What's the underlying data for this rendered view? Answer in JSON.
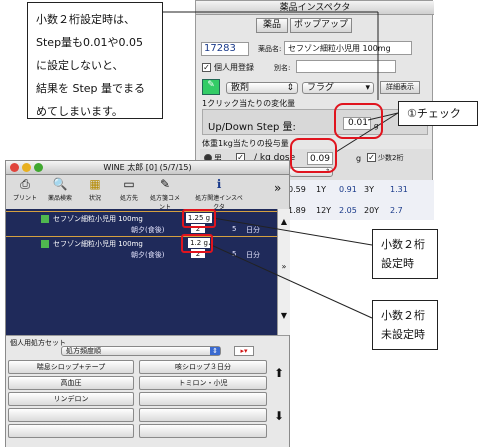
{
  "callouts": {
    "main_lines": [
      "小数２桁設定時は、",
      "Step量も0.01や0.05",
      "に設定しないと、",
      "結果を Step 量でまる",
      "めてしまいます。"
    ],
    "check_label": "①チェック",
    "two_digit_set": [
      "小数２桁",
      "設定時"
    ],
    "two_digit_unset": [
      "小数２桁",
      "未設定時"
    ]
  },
  "inspector": {
    "title": "薬品インスペクタ",
    "tabs": [
      "薬品",
      "ポップアップ"
    ],
    "drug_code": "17283",
    "drug_name_label": "薬品名:",
    "drug_name": "セフゾン細粒小児用 100mg",
    "personal_use_label": "個人用登録",
    "alias_label": "別名:",
    "dosage_form": "散剤",
    "flag": "フラグ",
    "details_button": "詳細表示",
    "click_change_label": "1クリック当たりの変化量",
    "updown_label": "Up/Down Step 量:",
    "updown_value": "0.01",
    "updown_unit": "g",
    "weight_label": "体重1kg当たりの投与量",
    "sex_label": "男",
    "per_kg_label": "/ kg dose",
    "dose_value": "0.09",
    "dose_unit": "g",
    "two_decimal_label": "少数2桁",
    "table_row1": [
      "0.59",
      "1Y",
      "0.91",
      "3Y",
      "1.31"
    ],
    "table_row2": [
      "1.89",
      "12Y",
      "2.05",
      "20Y",
      "2.7"
    ]
  },
  "main_window": {
    "title": "WINE 太郎 [0] (5/7/15)",
    "toolbar": [
      {
        "label": "プリント",
        "icon": "printer-icon",
        "glyph": "⎙"
      },
      {
        "label": "薬品検索",
        "icon": "search-icon",
        "glyph": "🔍"
      },
      {
        "label": "状況",
        "icon": "status-icon",
        "glyph": "▦"
      },
      {
        "label": "処方先",
        "icon": "dropdown-icon",
        "glyph": "▭"
      },
      {
        "label": "処方箋コメント",
        "icon": "comment-icon",
        "glyph": "✎"
      },
      {
        "label": "処方関連インスペクタ",
        "icon": "info-icon",
        "glyph": "ℹ"
      }
    ],
    "more_glyph": "»",
    "prescriptions": [
      {
        "name": "セフゾン細粒小児用 100mg",
        "dose": "1.25 g",
        "timing": "朝夕(食後)",
        "count": "2",
        "days": "5",
        "days_unit": "日分"
      },
      {
        "name": "セフゾン細粒小児用 100mg",
        "dose": "1.2 g",
        "timing": "朝夕(食後)",
        "count": "2",
        "days": "5",
        "days_unit": "日分"
      }
    ],
    "set_panel_title": "個人用処方セット",
    "set_category": "処方頻度順",
    "set_buttons": [
      "喘息シロップ+テープ",
      "咳シロップ３日分",
      "高血圧",
      "トミロン・小児",
      "リンデロン"
    ]
  }
}
